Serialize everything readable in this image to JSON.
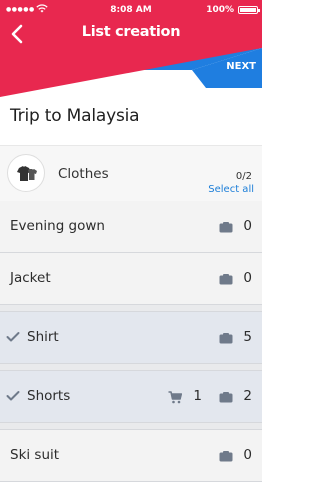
{
  "status_bar": {
    "time": "8:08 AM",
    "battery": "100%"
  },
  "nav": {
    "title": "List creation",
    "next_label": "NEXT"
  },
  "list_title": "Trip to Malaysia",
  "category": {
    "label": "Clothes",
    "count": "0/2",
    "select_all": "Select all",
    "icon": "tshirt-icon"
  },
  "items": [
    {
      "name": "Evening gown",
      "qty": "0",
      "selected": false
    },
    {
      "name": "Jacket",
      "qty": "0",
      "selected": false
    },
    {
      "name": "Shirt",
      "qty": "5",
      "selected": true
    },
    {
      "name": "Shorts",
      "qty": "2",
      "cart": "1",
      "selected": true
    },
    {
      "name": "Ski suit",
      "qty": "0",
      "selected": false
    }
  ],
  "colors": {
    "header_red": "#e8284f",
    "header_blue": "#1f7ee0",
    "link_blue": "#1c7ed8",
    "icon_gray": "#6f7a8a"
  }
}
